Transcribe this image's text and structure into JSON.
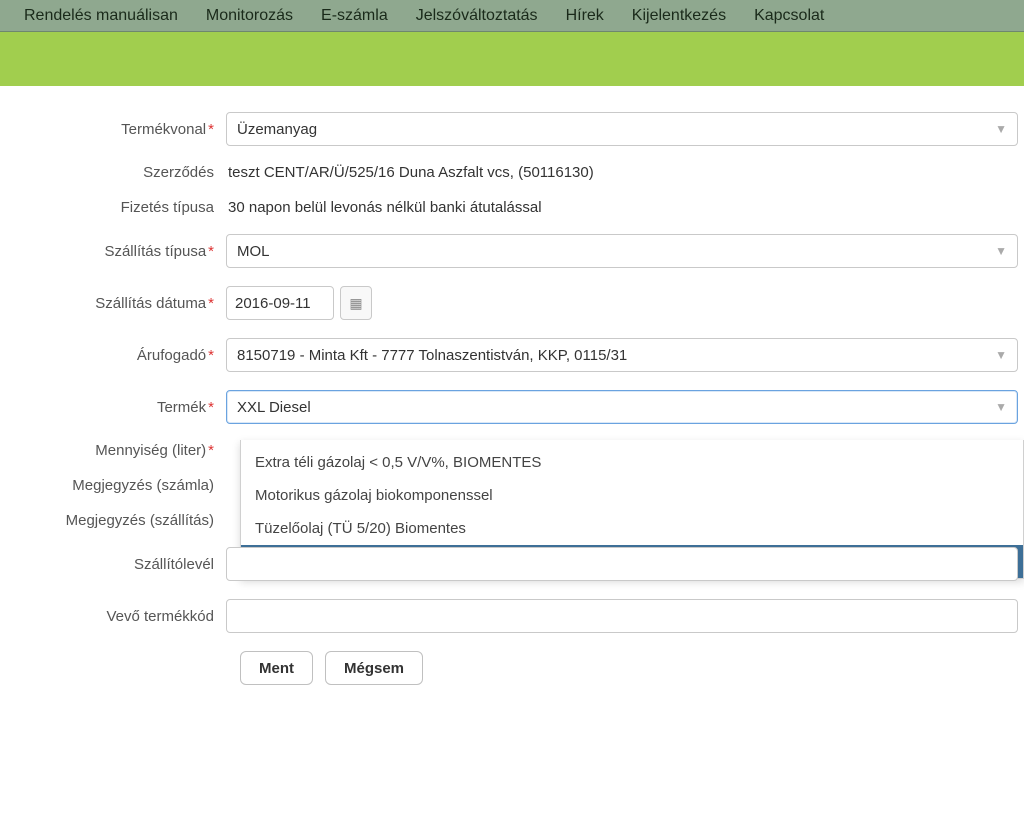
{
  "nav": {
    "items": [
      "Rendelés manuálisan",
      "Monitorozás",
      "E-számla",
      "Jelszóváltoztatás",
      "Hírek",
      "Kijelentkezés",
      "Kapcsolat"
    ]
  },
  "form": {
    "product_line": {
      "label": "Termékvonal",
      "value": "Üzemanyag"
    },
    "contract": {
      "label": "Szerződés",
      "value": "teszt CENT/AR/Ü/525/16 Duna Aszfalt vcs, (50116130)"
    },
    "payment_type": {
      "label": "Fizetés típusa",
      "value": "30 napon belül levonás nélkül banki átutalással"
    },
    "delivery_type": {
      "label": "Szállítás típusa",
      "value": "MOL"
    },
    "delivery_date": {
      "label": "Szállítás dátuma",
      "value": "2016-09-11"
    },
    "consignee": {
      "label": "Árufogadó",
      "value": "8150719 - Minta Kft - 7777 Tolnaszentistván, KKP, 0115/31"
    },
    "product": {
      "label": "Termék",
      "value": "XXL Diesel",
      "options": [
        "Extra téli gázolaj < 0,5 V/V%, BIOMENTES",
        "Motorikus gázolaj biokomponenssel",
        "Tüzelőolaj (TÜ 5/20) Biomentes",
        "XXL Diesel"
      ],
      "selected_index": 3
    },
    "quantity": {
      "label": "Mennyiség (liter)",
      "value": ""
    },
    "note_invoice": {
      "label": "Megjegyzés (számla)",
      "value": ""
    },
    "note_delivery": {
      "label": "Megjegyzés (szállítás)",
      "value": ""
    },
    "delivery_note": {
      "label": "Szállítólevél",
      "value": ""
    },
    "buyer_code": {
      "label": "Vevő termékkód",
      "value": ""
    }
  },
  "buttons": {
    "save": "Ment",
    "cancel": "Mégsem"
  }
}
